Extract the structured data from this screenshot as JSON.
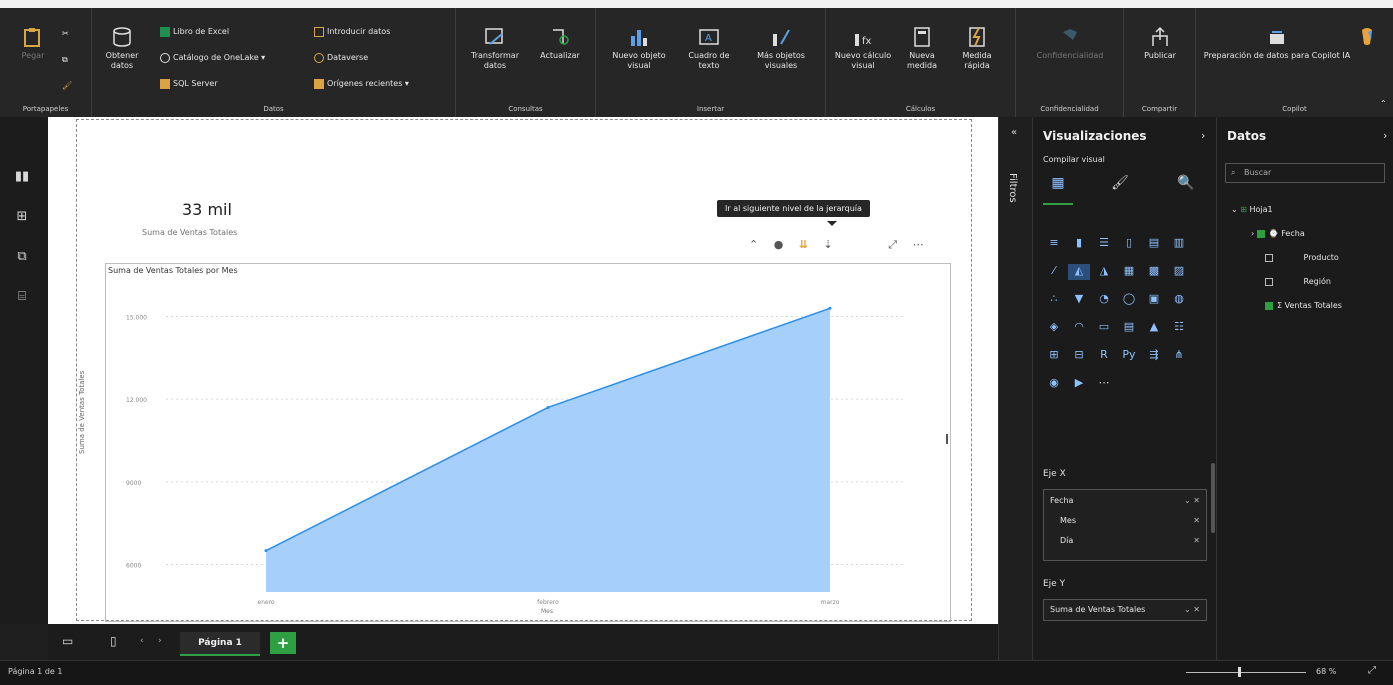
{
  "ribbon": {
    "groups": [
      {
        "name": "Portapapeles",
        "buttons": [
          "Pegar"
        ]
      },
      {
        "name": "Datos",
        "buttons": [
          "Obtener datos",
          "Libro de Excel",
          "Catálogo de OneLake",
          "SQL Server",
          "Introducir datos",
          "Dataverse",
          "Orígenes recientes"
        ]
      },
      {
        "name": "Consultas",
        "buttons": [
          "Transformar datos",
          "Actualizar"
        ]
      },
      {
        "name": "Insertar",
        "buttons": [
          "Nuevo objeto visual",
          "Cuadro de texto",
          "Más objetos visuales"
        ]
      },
      {
        "name": "Cálculos",
        "buttons": [
          "Nuevo cálculo visual",
          "Nueva medida",
          "Medida rápida"
        ]
      },
      {
        "name": "Confidencialidad",
        "buttons": [
          "Confidencialidad"
        ]
      },
      {
        "name": "Compartir",
        "buttons": [
          "Publicar"
        ]
      },
      {
        "name": "Copilot",
        "buttons": [
          "Preparación de datos para Copilot IA",
          "Copilot"
        ]
      }
    ]
  },
  "canvas": {
    "card_value": "33 mil",
    "card_label": "Suma de Ventas Totales",
    "tooltip": "Ir al siguiente nivel de la jerarquía",
    "chart_title": "Suma de Ventas Totales por Mes",
    "ylabel": "Suma de Ventas Totales",
    "xlabel": "Mes"
  },
  "chart_data": {
    "type": "area",
    "title": "Suma de Ventas Totales por Mes",
    "xlabel": "Mes",
    "ylabel": "Suma de Ventas Totales",
    "categories": [
      "enero",
      "febrero",
      "marzo"
    ],
    "values": [
      6500,
      11700,
      15300
    ],
    "ylim": [
      5000,
      16000
    ],
    "yticks": [
      6000,
      9000,
      12000,
      15000
    ],
    "grid": true,
    "color": "#a6cffb",
    "line_color": "#2b8fe8"
  },
  "pages": {
    "current": "Página 1",
    "status": "Página 1 de 1",
    "zoom": "68 %"
  },
  "filters": {
    "label": "Filtros"
  },
  "viz": {
    "title": "Visualizaciones",
    "subtitle": "Compilar visual",
    "ejeX_label": "Eje X",
    "ejeX_fields": [
      "Fecha",
      "Mes",
      "Día"
    ],
    "ejeY_label": "Eje Y",
    "ejeY_field": "Suma de Ventas Totales"
  },
  "datos": {
    "title": "Datos",
    "search_placeholder": "Buscar",
    "table": "Hoja1",
    "fields": [
      "Fecha",
      "Producto",
      "Región",
      "Ventas Totales"
    ]
  }
}
